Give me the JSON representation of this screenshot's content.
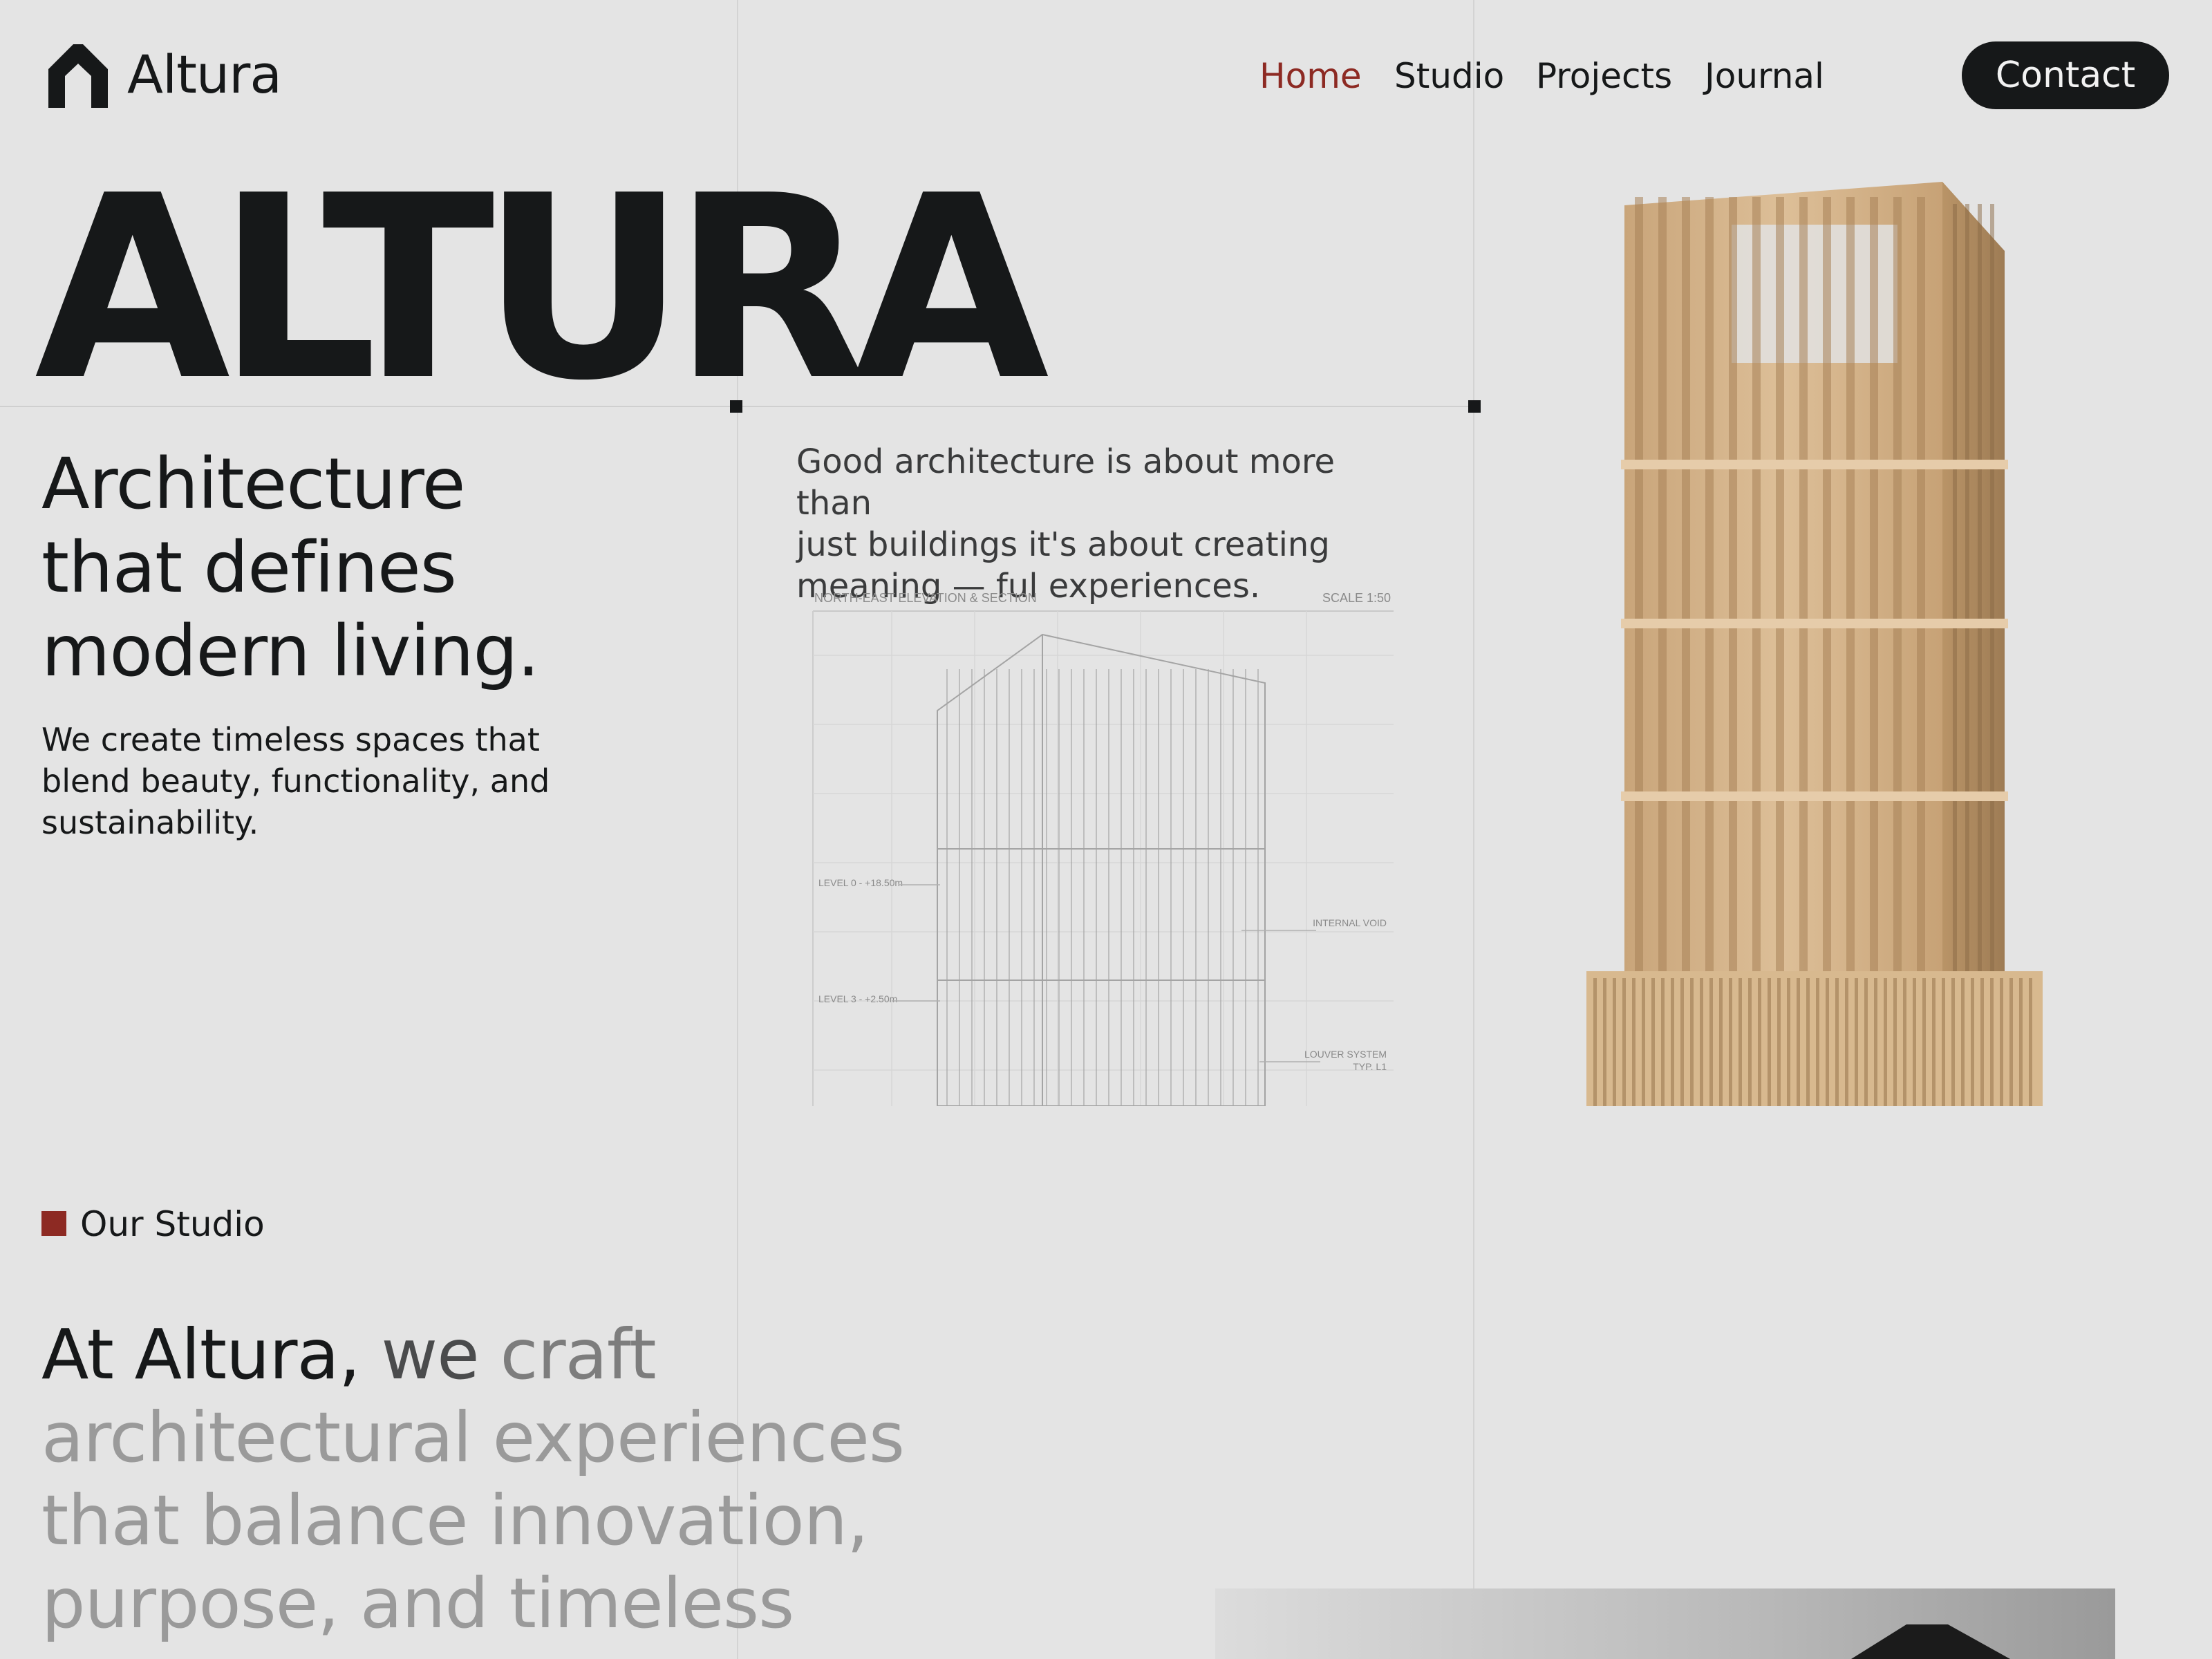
{
  "header": {
    "brand": "Altura",
    "nav": {
      "home": "Home",
      "studio": "Studio",
      "projects": "Projects",
      "journal": "Journal"
    },
    "contact_label": "Contact"
  },
  "hero": {
    "title": "ALTURA",
    "tagline": [
      "Architecture",
      "that defines",
      "modern living."
    ],
    "subtext": [
      "We create timeless spaces that",
      "blend beauty, functionality, and",
      "sustainability."
    ],
    "quote": [
      "Good architecture is about more than",
      "just buildings it's about creating",
      "meaning —  ful experiences."
    ]
  },
  "drawing": {
    "title": "NORTH-EAST ELEVATION & SECTION",
    "scale": "SCALE 1:50",
    "level_0": "LEVEL 0 - +18.50m",
    "level_3": "LEVEL 3 - +2.50m",
    "internal_void": "INTERNAL VOID",
    "louver_1": "LOUVER SYSTEM",
    "louver_2": "TYP. L1"
  },
  "studio": {
    "label": "Our Studio",
    "text_dark": "At Altura,",
    "text_mid": " we",
    "text_light": " craft",
    "text_rest": " architectural experiences that balance innovation, purpose, and timeless"
  },
  "colors": {
    "background": "#e4e4e4",
    "ink": "#161819",
    "accent": "#8d2a23",
    "wood": "#d2b48c"
  }
}
